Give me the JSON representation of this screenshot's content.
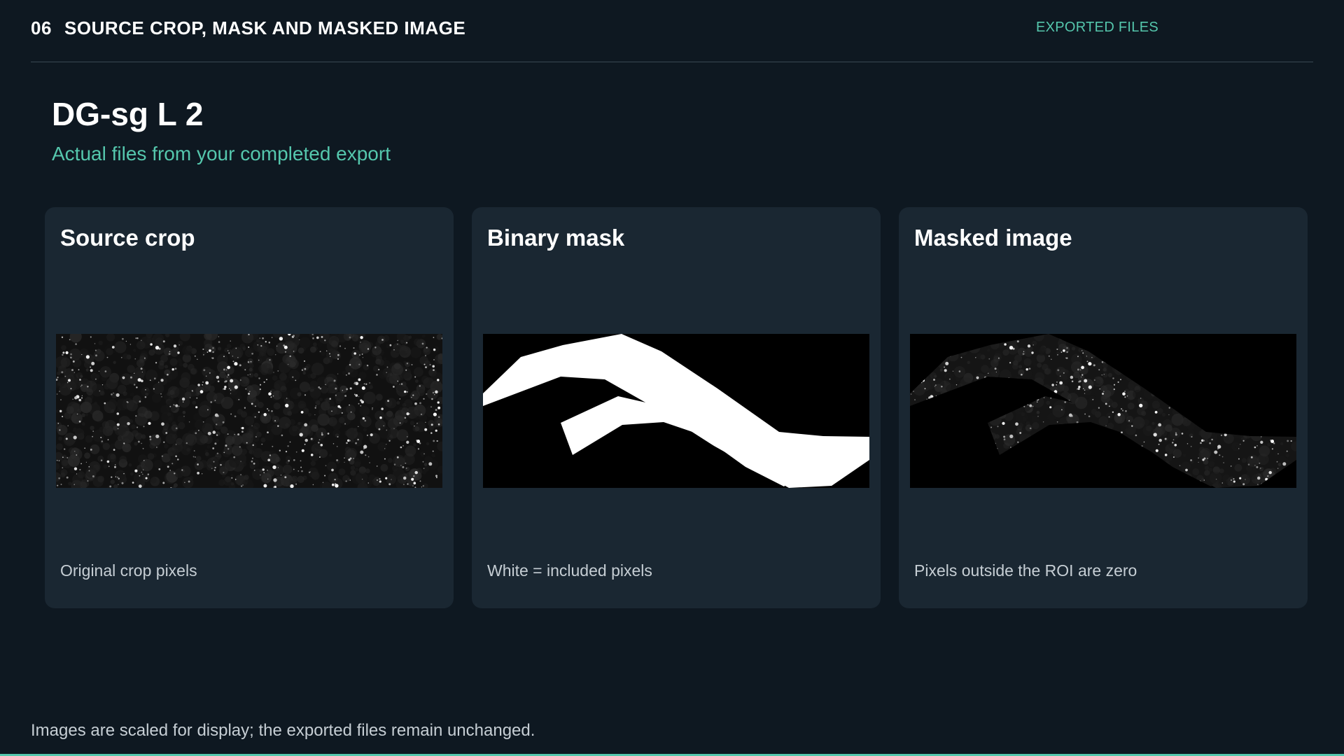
{
  "header": {
    "section_number": "06",
    "section_title": "SOURCE CROP, MASK AND MASKED IMAGE",
    "section_tag": "EXPORTED FILES"
  },
  "roi": {
    "name": "DG-sg L 2",
    "subtitle": "Actual files from your completed export"
  },
  "cards": [
    {
      "title": "Source crop",
      "caption": "Original crop pixels",
      "image": "source-crop-microscopy"
    },
    {
      "title": "Binary mask",
      "caption": "White = included pixels",
      "image": "binary-mask"
    },
    {
      "title": "Masked image",
      "caption": "Pixels outside the ROI are zero",
      "image": "masked-microscopy"
    }
  ],
  "footer": {
    "note": "Images are scaled for display; the exported files remain unchanged."
  },
  "colors": {
    "background": "#0e1821",
    "card": "#1a2732",
    "accent": "#55c7ad",
    "text_muted": "#c6ced4"
  }
}
